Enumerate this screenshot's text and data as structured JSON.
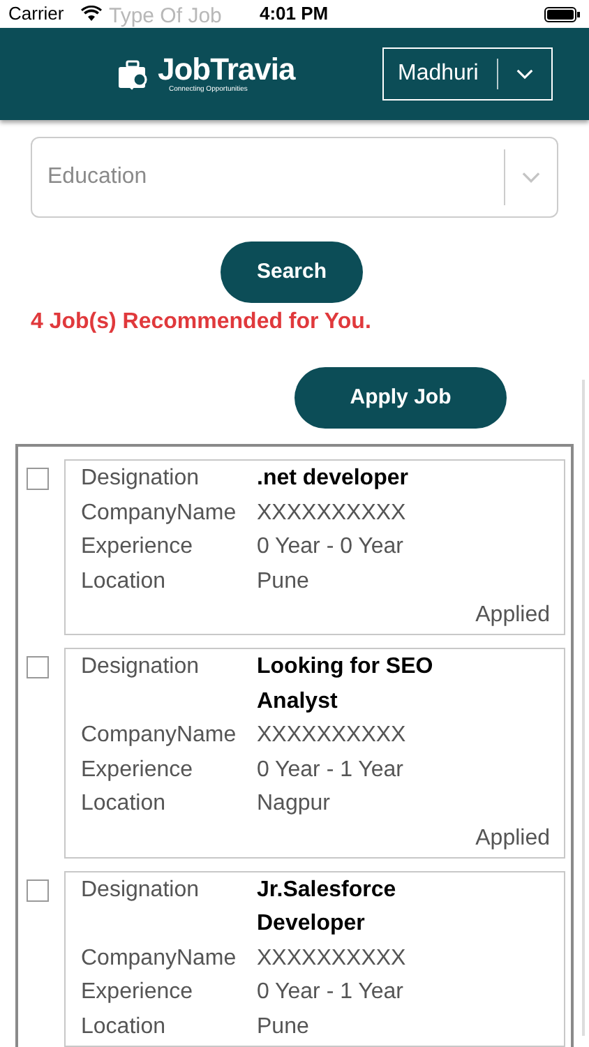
{
  "status_bar": {
    "carrier": "Carrier",
    "time": "4:01 PM"
  },
  "behind_field": {
    "placeholder": "Type Of Job"
  },
  "header": {
    "brand": "JobTravia",
    "tagline": "Connecting Opportunities",
    "user": "Madhuri"
  },
  "education_field": {
    "placeholder": "Education"
  },
  "search_button": "Search",
  "result_message": "4 Job(s) Recommended for You.",
  "apply_button": "Apply Job",
  "jobs": [
    {
      "checked": false,
      "fields": [
        {
          "label": "Designation",
          "value": ".net developer"
        },
        {
          "label": "CompanyName",
          "value": "XXXXXXXXXX"
        },
        {
          "label": "Experience",
          "value": "0 Year - 0 Year"
        },
        {
          "label": "Location",
          "value": "Pune"
        }
      ],
      "status": "Applied"
    },
    {
      "checked": false,
      "fields": [
        {
          "label": "Designation",
          "value": "Looking for SEO Analyst"
        },
        {
          "label": "CompanyName",
          "value": "XXXXXXXXXX"
        },
        {
          "label": "Experience",
          "value": "0 Year - 1 Year"
        },
        {
          "label": "Location",
          "value": "Nagpur"
        }
      ],
      "status": "Applied"
    },
    {
      "checked": false,
      "fields": [
        {
          "label": "Designation",
          "value": "Jr.Salesforce Developer"
        },
        {
          "label": "CompanyName",
          "value": "XXXXXXXXXX"
        },
        {
          "label": "Experience",
          "value": "0 Year - 1 Year"
        },
        {
          "label": "Location",
          "value": "Pune"
        }
      ]
    }
  ]
}
